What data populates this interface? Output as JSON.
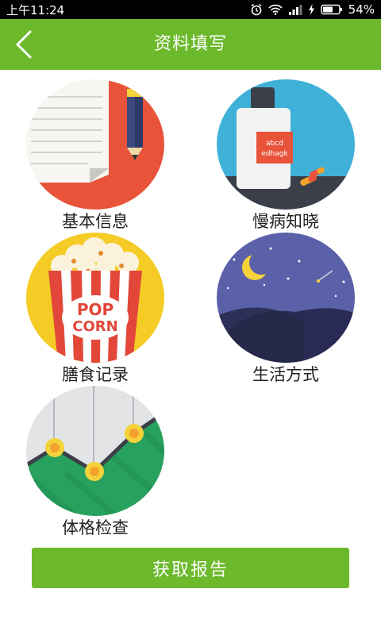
{
  "status_bar": {
    "time": "上午11:24",
    "battery": "54%"
  },
  "header": {
    "title": "资料填写"
  },
  "tiles": [
    {
      "label": "基本信息"
    },
    {
      "label": "慢病知晓",
      "bottle_text_1": "abcd",
      "bottle_text_2": "edhagk"
    },
    {
      "label": "膳食记录",
      "popcorn_text_1": "POP",
      "popcorn_text_2": "CORN"
    },
    {
      "label": "生活方式"
    },
    {
      "label": "体格检查"
    }
  ],
  "footer": {
    "report_button": "获取报告"
  },
  "colors": {
    "brand_green": "#6cb92c"
  }
}
